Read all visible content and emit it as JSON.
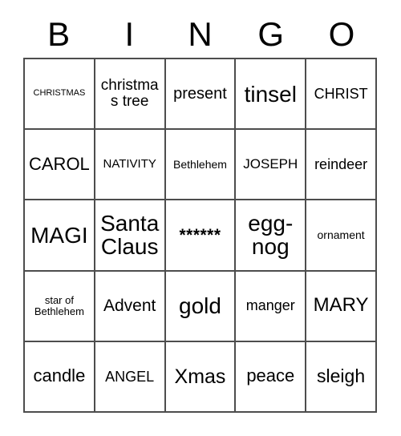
{
  "card": {
    "title": "BINGO",
    "header_letters": [
      "B",
      "I",
      "N",
      "G",
      "O"
    ],
    "grid_size": "5x5",
    "colors": {
      "border": "#4d4d4d",
      "text": "#000000",
      "background": "#ffffff"
    },
    "rows": [
      [
        {
          "text": "CHRISTMAS",
          "font_size": "11px"
        },
        {
          "text": "christmas tree",
          "font_size": "19px"
        },
        {
          "text": "present",
          "font_size": "20px"
        },
        {
          "text": "tinsel",
          "font_size": "28px"
        },
        {
          "text": "CHRIST",
          "font_size": "18px"
        }
      ],
      [
        {
          "text": "CAROL",
          "font_size": "22px"
        },
        {
          "text": "NATIVITY",
          "font_size": "15px"
        },
        {
          "text": "Bethlehem",
          "font_size": "14px"
        },
        {
          "text": "JOSEPH",
          "font_size": "17px"
        },
        {
          "text": "reindeer",
          "font_size": "18px"
        }
      ],
      [
        {
          "text": "MAGI",
          "font_size": "28px"
        },
        {
          "text": "Santa Claus",
          "font_size": "28px"
        },
        {
          "text": "******",
          "font_size": "21px",
          "free_space": true
        },
        {
          "text": "egg-nog",
          "font_size": "28px"
        },
        {
          "text": "ornament",
          "font_size": "14px"
        }
      ],
      [
        {
          "text": "star of Bethlehem",
          "font_size": "13px"
        },
        {
          "text": "Advent",
          "font_size": "21px"
        },
        {
          "text": "gold",
          "font_size": "28px"
        },
        {
          "text": "manger",
          "font_size": "18px"
        },
        {
          "text": "MARY",
          "font_size": "24px"
        }
      ],
      [
        {
          "text": "candle",
          "font_size": "22px"
        },
        {
          "text": "ANGEL",
          "font_size": "18px"
        },
        {
          "text": "Xmas",
          "font_size": "25px"
        },
        {
          "text": "peace",
          "font_size": "22px"
        },
        {
          "text": "sleigh",
          "font_size": "23px"
        }
      ]
    ]
  }
}
